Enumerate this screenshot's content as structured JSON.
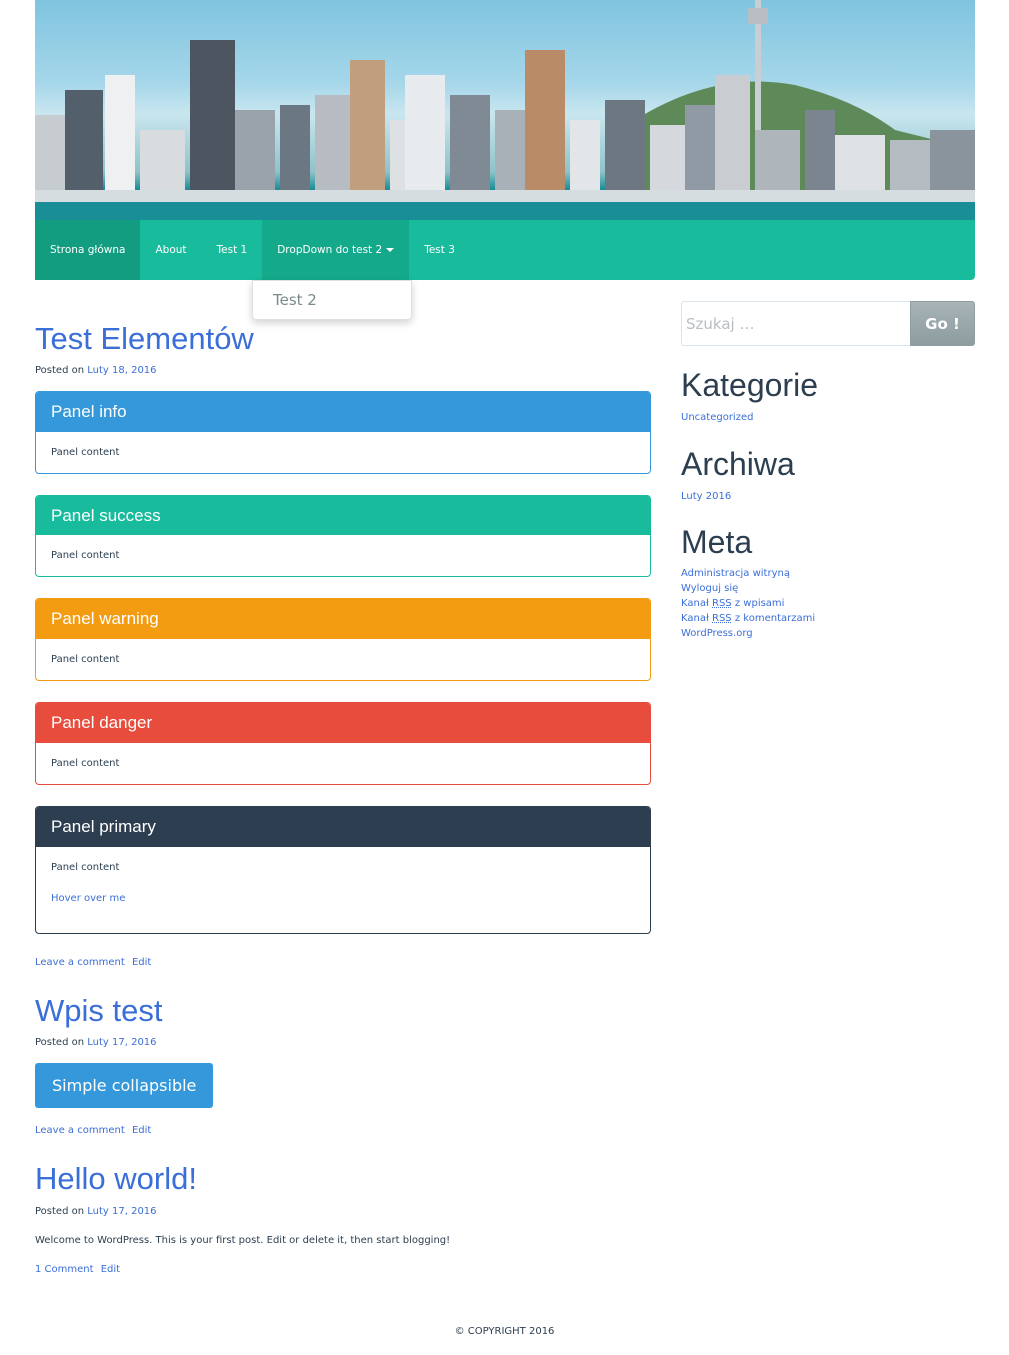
{
  "nav": {
    "items": [
      {
        "label": "Strona główna"
      },
      {
        "label": "About"
      },
      {
        "label": "Test 1"
      },
      {
        "label": "DropDown do test 2"
      },
      {
        "label": "Test 3"
      }
    ],
    "dropdown_items": [
      "Test 2"
    ]
  },
  "colors": {
    "nav": "#18bc9c",
    "info": "#3498db",
    "success": "#18bc9c",
    "warning": "#f39c12",
    "danger": "#e74c3c",
    "primary": "#2c3e50",
    "link": "#3b6fd8"
  },
  "posts": [
    {
      "title": "Test Elementów",
      "posted_label": "Posted on",
      "date": "Luty 18, 2016",
      "panels": [
        {
          "heading": "Panel info",
          "content": "Panel content"
        },
        {
          "heading": "Panel success",
          "content": "Panel content"
        },
        {
          "heading": "Panel warning",
          "content": "Panel content"
        },
        {
          "heading": "Panel danger",
          "content": "Panel content"
        },
        {
          "heading": "Panel primary",
          "content": "Panel content",
          "link": "Hover over me"
        }
      ],
      "footer_links": [
        "Leave a comment",
        "Edit"
      ]
    },
    {
      "title": "Wpis test",
      "posted_label": "Posted on",
      "date": "Luty 17, 2016",
      "button": "Simple collapsible",
      "footer_links": [
        "Leave a comment",
        "Edit"
      ]
    },
    {
      "title": "Hello world!",
      "posted_label": "Posted on",
      "date": "Luty 17, 2016",
      "content": "Welcome to WordPress. This is your first post. Edit or delete it, then start blogging!",
      "footer_links": [
        "1 Comment",
        "Edit"
      ]
    }
  ],
  "sidebar": {
    "search_placeholder": "Szukaj …",
    "search_button": "Go !",
    "categories_title": "Kategorie",
    "categories": [
      "Uncategorized"
    ],
    "archives_title": "Archiwa",
    "archives": [
      "Luty 2016"
    ],
    "meta_title": "Meta",
    "meta": {
      "admin": "Administracja witryną",
      "logout": "Wyloguj się",
      "rss_prefix": "Kanał",
      "rss_abbr": "RSS",
      "rss_posts_suffix": "z wpisami",
      "rss_comments_suffix": "z komentarzami",
      "wp": "WordPress.org"
    }
  },
  "footer": {
    "copyright": "© COPYRIGHT 2016"
  }
}
